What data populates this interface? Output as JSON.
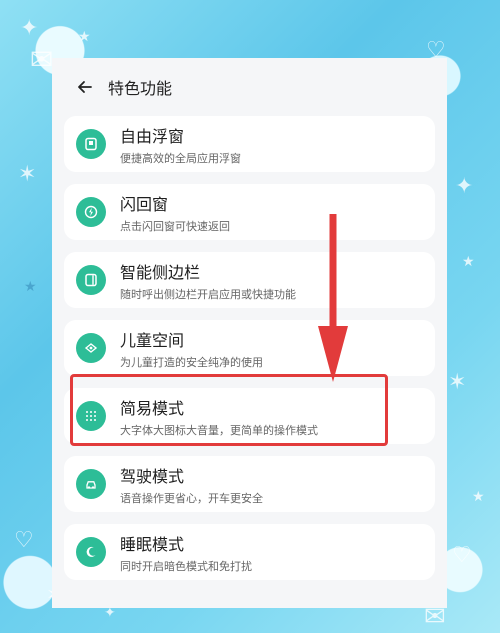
{
  "page": {
    "title": "特色功能"
  },
  "items": [
    {
      "title": "自由浮窗",
      "subtitle": "便捷高效的全局应用浮窗",
      "icon": "floating-window-icon"
    },
    {
      "title": "闪回窗",
      "subtitle": "点击闪回窗可快速返回",
      "icon": "flash-back-icon"
    },
    {
      "title": "智能侧边栏",
      "subtitle": "随时呼出侧边栏开启应用或快捷功能",
      "icon": "sidebar-icon"
    },
    {
      "title": "儿童空间",
      "subtitle": "为儿童打造的安全纯净的使用",
      "icon": "kids-space-icon"
    },
    {
      "title": "简易模式",
      "subtitle": "大字体大图标大音量，更简单的操作模式",
      "icon": "simple-mode-icon"
    },
    {
      "title": "驾驶模式",
      "subtitle": "语音操作更省心，开车更安全",
      "icon": "car-icon"
    },
    {
      "title": "睡眠模式",
      "subtitle": "同时开启暗色模式和免打扰",
      "icon": "moon-icon"
    }
  ],
  "colors": {
    "accent": "#2dbd97",
    "highlight": "#e23b3b",
    "background": "#f5f6f8"
  }
}
